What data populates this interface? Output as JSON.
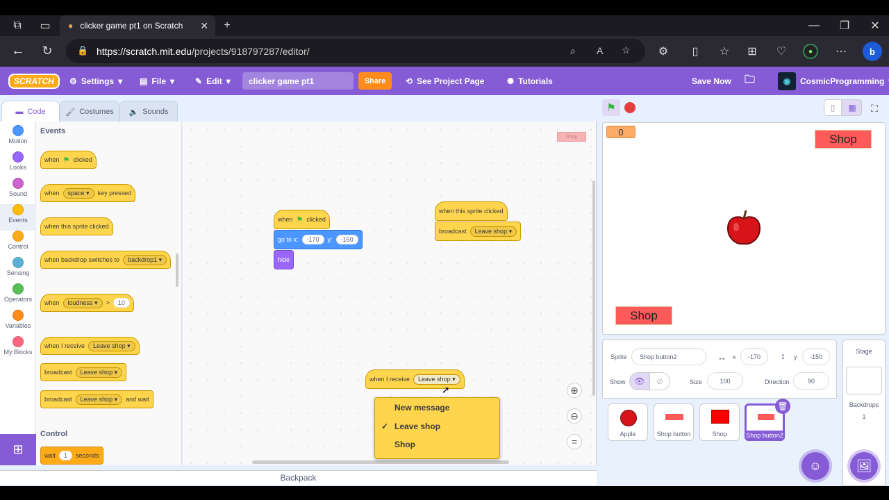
{
  "browser": {
    "tab_title": "clicker game pt1 on Scratch",
    "url_host": "https://scratch.mit.edu",
    "url_path": "/projects/918797287/editor/"
  },
  "menubar": {
    "logo": "SCRATCH",
    "settings": "Settings",
    "file": "File",
    "edit": "Edit",
    "project_title": "clicker game pt1",
    "share": "Share",
    "see_project": "See Project Page",
    "tutorials": "Tutorials",
    "save_now": "Save Now",
    "username": "CosmicProgramming"
  },
  "tabs": {
    "code": "Code",
    "costumes": "Costumes",
    "sounds": "Sounds"
  },
  "categories": [
    {
      "label": "Motion",
      "color": "#4c97ff"
    },
    {
      "label": "Looks",
      "color": "#9966ff"
    },
    {
      "label": "Sound",
      "color": "#cf63cf"
    },
    {
      "label": "Events",
      "color": "#ffbf00"
    },
    {
      "label": "Control",
      "color": "#ffab19"
    },
    {
      "label": "Sensing",
      "color": "#5cb1d6"
    },
    {
      "label": "Operators",
      "color": "#59c059"
    },
    {
      "label": "Variables",
      "color": "#ff8c1a"
    },
    {
      "label": "My Blocks",
      "color": "#ff6680"
    }
  ],
  "palette": {
    "events_title": "Events",
    "when": "when",
    "clicked": "clicked",
    "key_space": "space",
    "key_pressed": "key pressed",
    "sprite_clicked": "when this sprite clicked",
    "backdrop_switches": "when backdrop switches to",
    "backdrop1": "backdrop1",
    "loudness": "loudness",
    "gt": ">",
    "ten": "10",
    "when_i_receive": "when I receive",
    "leave_shop": "Leave shop",
    "broadcast": "broadcast",
    "and_wait": "and wait",
    "control_title": "Control",
    "wait": "wait",
    "one": "1",
    "seconds": "seconds"
  },
  "script": {
    "goto": "go to x:",
    "x": "-170",
    "y_label": "y:",
    "y": "-150",
    "hide": "hide",
    "ghost_label": "Shop"
  },
  "dropdown_menu": {
    "items": [
      "New message",
      "Leave shop",
      "Shop"
    ],
    "checkmark": "✓"
  },
  "backpack": "Backpack",
  "stage": {
    "score": "0",
    "shop_top": "Shop",
    "shop_bottom": "Shop"
  },
  "sprite_info": {
    "sprite_label": "Sprite",
    "sprite_name": "Shop button2",
    "x_label": "x",
    "x": "-170",
    "y_label": "y",
    "y": "-150",
    "show_label": "Show",
    "size_label": "Size",
    "size": "100",
    "direction_label": "Direction",
    "direction": "90"
  },
  "sprites": [
    "Apple",
    "Shop button",
    "Shop",
    "Shop button2"
  ],
  "stage_panel": {
    "title": "Stage",
    "backdrops_label": "Backdrops",
    "backdrops_count": "1"
  }
}
